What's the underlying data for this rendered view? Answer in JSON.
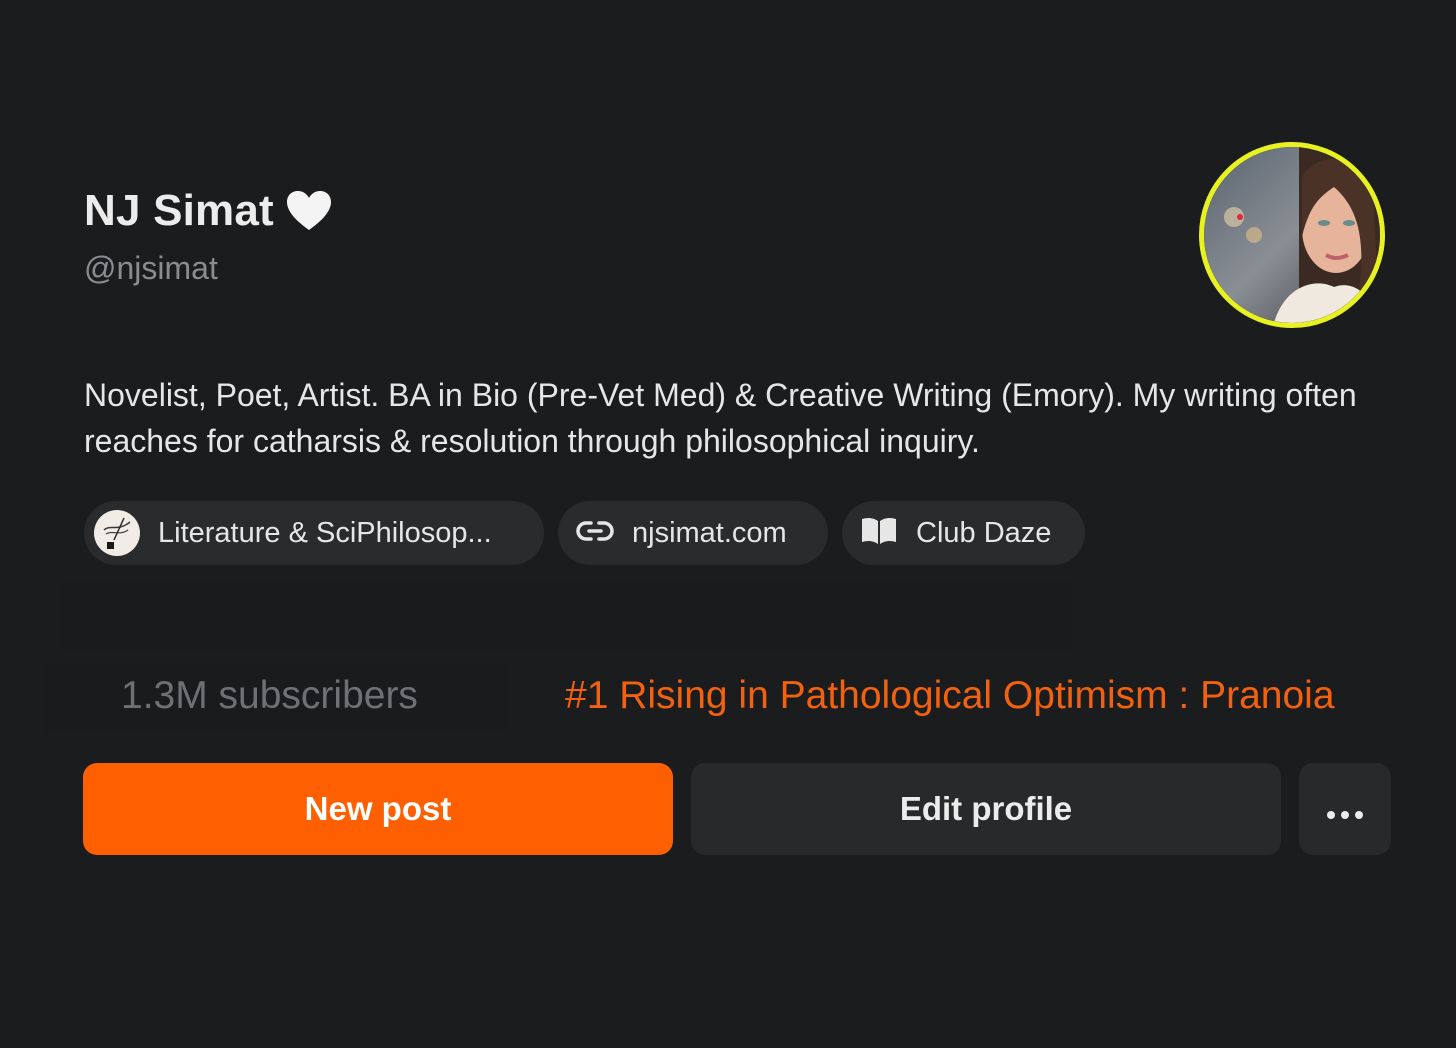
{
  "profile": {
    "display_name": "NJ Simat",
    "name_emoji_icon": "white-heart-icon",
    "handle": "@njsimat",
    "avatar_ring_color": "#e8f21f",
    "bio": "Novelist, Poet, Artist. BA in Bio (Pre-Vet Med) & Creative Writing (Emory). My writing often reaches for catharsis & resolution through philosophical inquiry."
  },
  "chips": [
    {
      "icon": "publication-logo-icon",
      "label": "Literature & SciPhilosop..."
    },
    {
      "icon": "link-icon",
      "label": "njsimat.com"
    },
    {
      "icon": "open-book-icon",
      "label": "Club Daze"
    }
  ],
  "stats": {
    "subscribers": "1.3M subscribers",
    "rank": "#1 Rising in Pathological Optimism : Pranoia",
    "rank_color": "#f2610f"
  },
  "actions": {
    "new_post": "New post",
    "edit_profile": "Edit profile",
    "more_icon": "ellipsis-icon",
    "accent_color": "#fe5f00"
  }
}
